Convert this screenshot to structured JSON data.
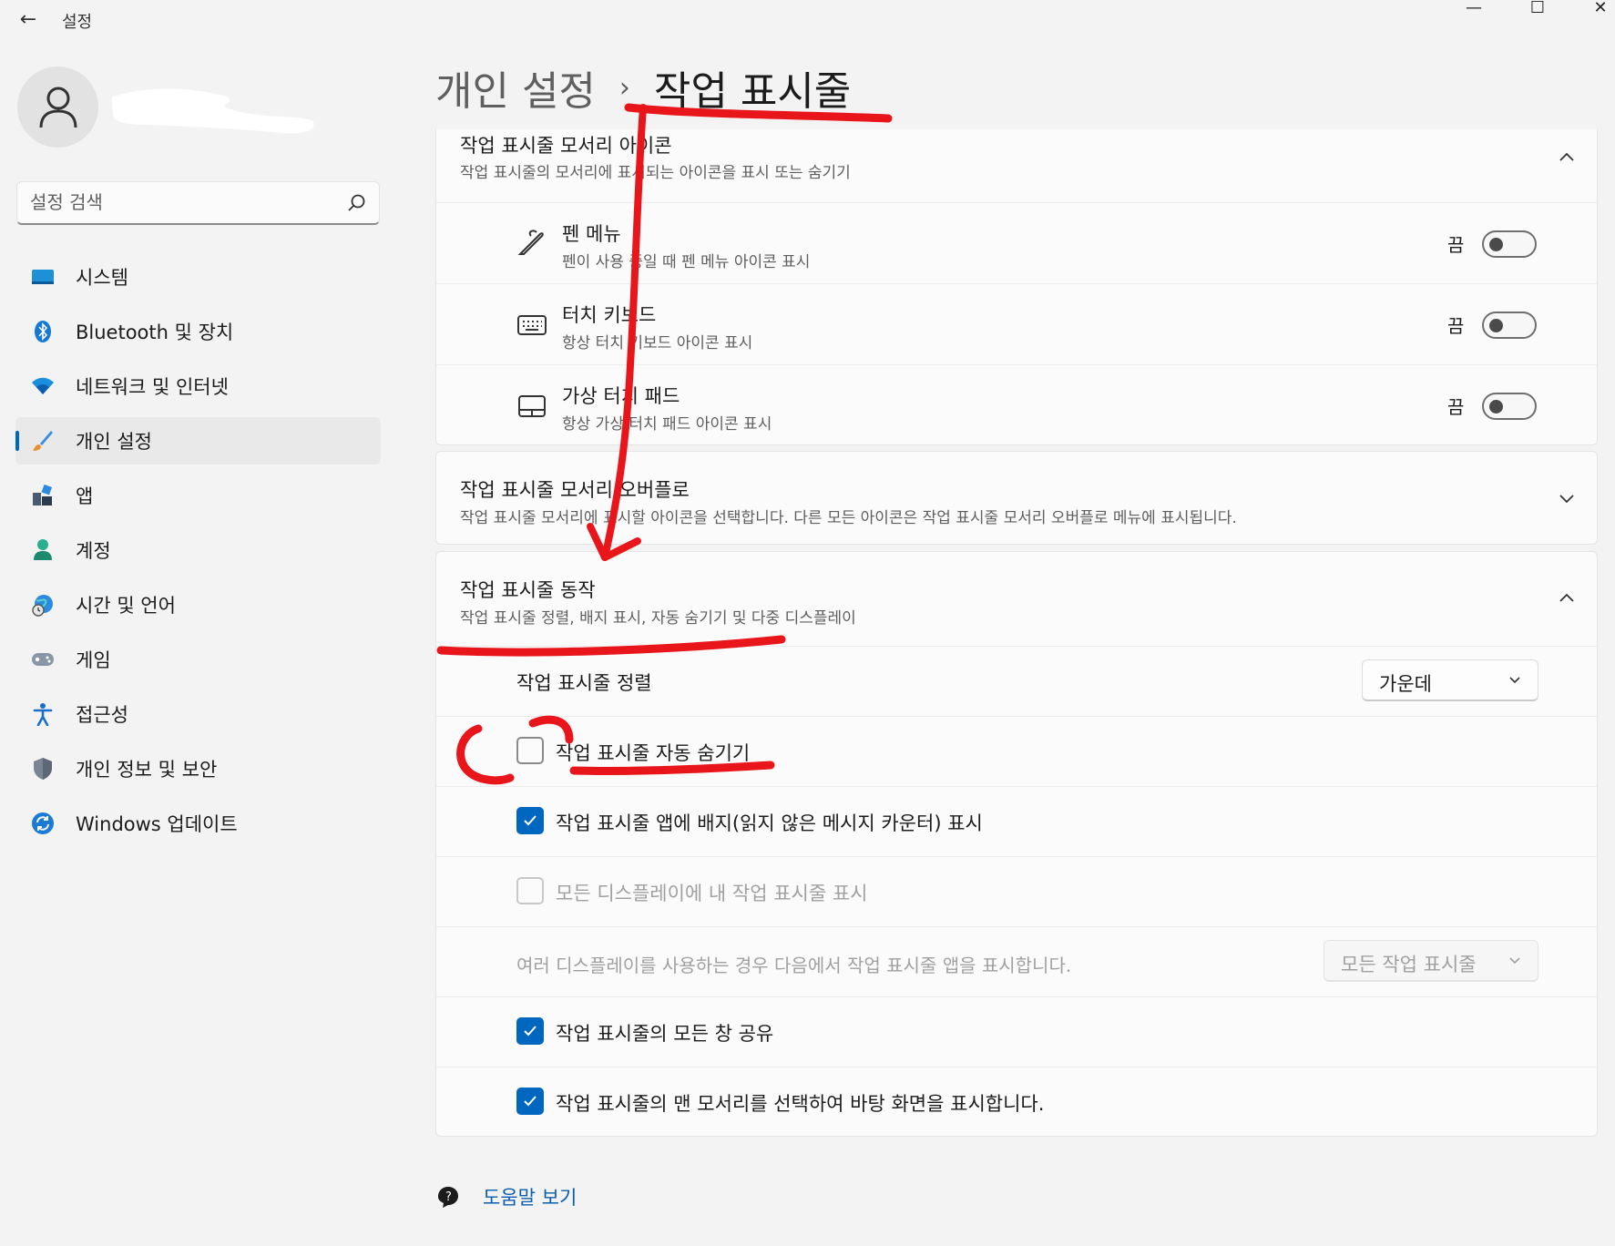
{
  "window": {
    "title": "설정",
    "back_glyph": "←",
    "min_glyph": "—",
    "max_glyph": "☐",
    "close_glyph": "✕"
  },
  "search": {
    "placeholder": "설정 검색",
    "icon": "search-icon"
  },
  "sidebar": {
    "items": [
      {
        "label": "시스템",
        "icon": "system-icon"
      },
      {
        "label": "Bluetooth 및 장치",
        "icon": "bluetooth-icon"
      },
      {
        "label": "네트워크 및 인터넷",
        "icon": "wifi-icon"
      },
      {
        "label": "개인 설정",
        "icon": "brush-icon",
        "selected": true
      },
      {
        "label": "앱",
        "icon": "apps-icon"
      },
      {
        "label": "계정",
        "icon": "account-icon"
      },
      {
        "label": "시간 및 언어",
        "icon": "time-language-icon"
      },
      {
        "label": "게임",
        "icon": "gaming-icon"
      },
      {
        "label": "접근성",
        "icon": "accessibility-icon"
      },
      {
        "label": "개인 정보 및 보안",
        "icon": "shield-icon"
      },
      {
        "label": "Windows 업데이트",
        "icon": "update-icon"
      }
    ]
  },
  "breadcrumb": {
    "parent": "개인 설정",
    "separator": "›",
    "current": "작업 표시줄"
  },
  "corner_icons": {
    "title": "작업 표시줄 모서리 아이콘",
    "description": "작업 표시줄의 모서리에 표시되는 아이콘을 표시 또는 숨기기",
    "items": [
      {
        "title": "펜 메뉴",
        "description": "펜이 사용 중일 때 펜 메뉴 아이콘 표시",
        "state": "끔",
        "icon": "pen-icon"
      },
      {
        "title": "터치 키보드",
        "description": "항상 터치 키보드 아이콘 표시",
        "state": "끔",
        "icon": "keyboard-icon"
      },
      {
        "title": "가상 터치 패드",
        "description": "항상 가상 터치 패드 아이콘 표시",
        "state": "끔",
        "icon": "touchpad-icon"
      }
    ]
  },
  "overflow": {
    "title": "작업 표시줄 모서리 오버플로",
    "description": "작업 표시줄 모서리에 표시할 아이콘을 선택합니다. 다른 모든 아이콘은 작업 표시줄 모서리 오버플로 메뉴에 표시됩니다."
  },
  "behaviors": {
    "title": "작업 표시줄 동작",
    "description": "작업 표시줄 정렬, 배지 표시, 자동 숨기기 및 다중 디스플레이",
    "alignment_label": "작업 표시줄 정렬",
    "alignment_value": "가운데",
    "autohide_label": "작업 표시줄 자동 숨기기",
    "badges_label": "작업 표시줄 앱에 배지(읽지 않은 메시지 카운터) 표시",
    "all_displays_label": "모든 디스플레이에 내 작업 표시줄 표시",
    "multi_display_label": "여러 디스플레이를 사용하는 경우 다음에서 작업 표시줄 앱을 표시합니다.",
    "multi_display_value": "모든 작업 표시줄",
    "share_label": "작업 표시줄의 모든 창 공유",
    "far_corner_label": "작업 표시줄의 맨 모서리를 선택하여 바탕 화면을 표시합니다."
  },
  "help": {
    "label": "도움말 보기"
  },
  "colors": {
    "accent": "#0067c0",
    "annotation": "#e8161b"
  }
}
